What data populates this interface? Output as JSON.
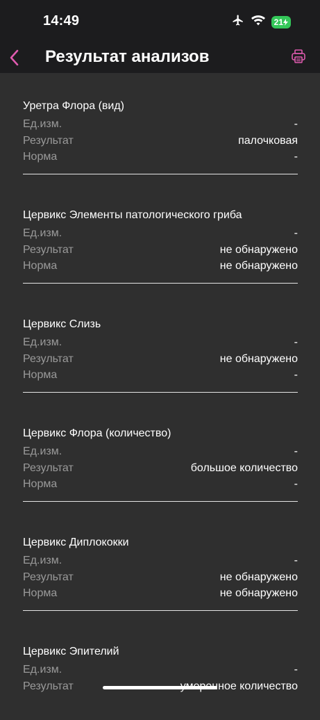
{
  "status": {
    "time": "14:49",
    "battery": "21"
  },
  "header": {
    "title": "Результат анализов"
  },
  "labels": {
    "unit": "Ед.изм.",
    "result": "Результат",
    "norm": "Норма"
  },
  "results": [
    {
      "name": "Уретра Флора (вид)",
      "unit": "-",
      "result": "палочковая",
      "norm": "-"
    },
    {
      "name": "Цервикс Элементы патологического гриба",
      "unit": "-",
      "result": "не обнаружено",
      "norm": "не обнаружено"
    },
    {
      "name": "Цервикс Слизь",
      "unit": "-",
      "result": "не обнаружено",
      "norm": "-"
    },
    {
      "name": "Цервикс Флора (количество)",
      "unit": "-",
      "result": "большое количество",
      "norm": "-"
    },
    {
      "name": "Цервикс Диплококки",
      "unit": "-",
      "result": "не обнаружено",
      "norm": "не обнаружено"
    },
    {
      "name": "Цервикс Эпителий",
      "unit": "-",
      "result": "умеренное количество",
      "norm": ""
    }
  ],
  "colors": {
    "accent": "#e05bb0",
    "background": "#2f2f2f",
    "bar": "#1c1c1e"
  },
  "icons": {
    "back": "chevron-left-icon",
    "print": "printer-icon"
  }
}
